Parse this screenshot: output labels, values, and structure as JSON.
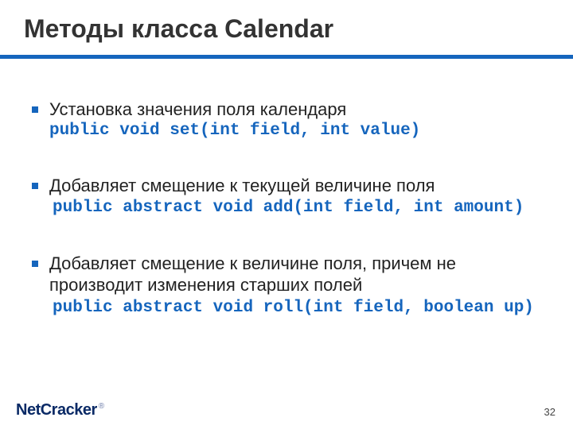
{
  "title": "Методы класса Calendar",
  "bullets": [
    {
      "text": "Установка значения поля календаря",
      "code": "public void set(int field, int value)",
      "tight": true
    },
    {
      "text": "Добавляет смещение к текущей величине поля",
      "code": "public abstract void add(int field, int amount)",
      "tight": false
    },
    {
      "text": "Добавляет смещение к величине поля, причем не производит изменения старших полей",
      "code": "public abstract void roll(int field, boolean up)",
      "tight": false
    }
  ],
  "logo": {
    "part1": "Net",
    "part2": "Cracker",
    "reg": "®"
  },
  "page": "32"
}
